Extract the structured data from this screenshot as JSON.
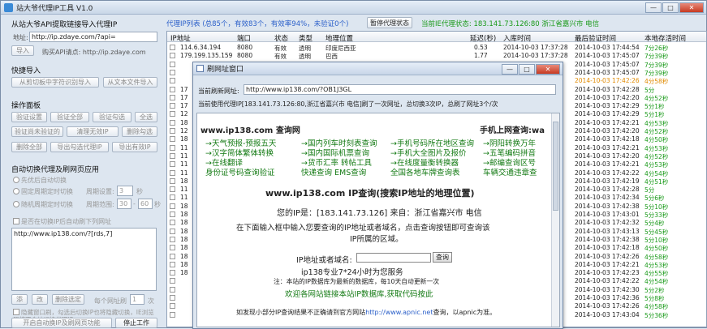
{
  "app": {
    "title": "站大爷代理IP工具 V1.0"
  },
  "left": {
    "api_section": "从站大爷API提取链接导入代理IP",
    "api_label": "地址:",
    "api_value": "http://ip.zdaye.com/?api=",
    "import_btn": "导入",
    "buy_label": "购买API请点: http://ip.zdaye.com",
    "quick_section": "快捷导入",
    "clip_btn": "从剪切板中字符识别导入",
    "text_btn": "从文本文件导入",
    "ops_section": "操作面板",
    "ops_row1": [
      "验证设置",
      "验证全部",
      "验证勾选",
      "全选"
    ],
    "ops_row2": [
      "验证尚未验证的",
      "清理无效IP",
      "删除勾选"
    ],
    "ops_row3": [
      "删除全部",
      "导出勾选代理IP",
      "导出有效IP"
    ],
    "auto_section": "自动切换代理及刷网页应用",
    "opt1": "先优后自动切换",
    "opt2": "固定周期定时切换",
    "opt2_label": "周期设置:",
    "opt2_value": "3",
    "opt2_unit": "秒",
    "opt3": "随机周期定时切换",
    "opt3_label": "周期范围:",
    "opt3_from": "30",
    "opt3_sep": "-",
    "opt3_to": "60",
    "opt3_unit": "秒",
    "refresh_check": "是否在切换IP后自动刷下列网址",
    "url_text": "http://www.ip138.com/?[rds,7]",
    "bottom_btns": [
      "添",
      "改",
      "删除选定"
    ],
    "per_ip_label": "每个网址刷",
    "per_ip_value": "1",
    "per_ip_unit": "次",
    "hide_check": "隐藏窗口刷，勾选后切换IP也将隐藏切换，IE浏览器将不会被切换代理IP",
    "start_btn": "开启自动换IP及刷网页功能",
    "stop_btn": "停止工作"
  },
  "topbar": {
    "summary": "代理IP列表 (总85个，有效83个，有效率94%，未验证0个)",
    "pause_btn": "暂停代理状态",
    "status": "当前IE代理状态: 183.141.73.126:80  浙江省嘉兴市 电信"
  },
  "table": {
    "headers": [
      "IP地址",
      "端口",
      "状态",
      "类型",
      "地理位置",
      "延迟(秒)",
      "入库时间",
      "最后验证时间",
      "本地存活时间"
    ],
    "rows": [
      {
        "ip": "114.6.34.194",
        "port": "8080",
        "status": "有效",
        "type": "透明",
        "loc": "印度尼西亚",
        "delay": "0.53",
        "added": "2014-10-03 17:37:28",
        "checked": "2014-10-03 17:44:54",
        "alive": "7分26秒",
        "ac": "g"
      },
      {
        "ip": "179.199.135.159",
        "port": "8080",
        "status": "有效",
        "type": "透明",
        "loc": "巴西",
        "delay": "1.77",
        "added": "2014-10-03 17:37:28",
        "checked": "2014-10-03 17:45:07",
        "alive": "7分39秒",
        "ac": "g"
      },
      {
        "ip": "",
        "port": "",
        "status": "",
        "type": "",
        "loc": "",
        "delay": "",
        "added": "",
        "checked": "2014-10-03 17:45:07",
        "alive": "7分39秒",
        "ac": "g"
      },
      {
        "ip": "",
        "port": "",
        "status": "",
        "type": "",
        "loc": "",
        "delay": "",
        "added": "",
        "checked": "2014-10-03 17:45:07",
        "alive": "7分39秒",
        "ac": "g"
      },
      {
        "ip": "",
        "port": "",
        "status": "",
        "type": "",
        "loc": "",
        "delay": "",
        "added": "",
        "checked": "2014-10-03 17:42:26",
        "alive": "4分58秒",
        "ac": "o"
      },
      {
        "ip": "17",
        "port": "",
        "status": "",
        "type": "",
        "loc": "",
        "delay": "",
        "added": "",
        "checked": "2014-10-03 17:42:28",
        "alive": "5分",
        "ac": "g"
      },
      {
        "ip": "17",
        "port": "",
        "status": "",
        "type": "",
        "loc": "",
        "delay": "",
        "added": "",
        "checked": "2014-10-03 17:42:20",
        "alive": "4分52秒",
        "ac": "g"
      },
      {
        "ip": "17",
        "port": "",
        "status": "",
        "type": "",
        "loc": "",
        "delay": "",
        "added": "",
        "checked": "2014-10-03 17:42:29",
        "alive": "5分1秒",
        "ac": "g"
      },
      {
        "ip": "12",
        "port": "",
        "status": "",
        "type": "",
        "loc": "",
        "delay": "",
        "added": "",
        "checked": "2014-10-03 17:42:29",
        "alive": "5分1秒",
        "ac": "g"
      },
      {
        "ip": "18",
        "port": "",
        "status": "",
        "type": "",
        "loc": "",
        "delay": "",
        "added": "",
        "checked": "2014-10-03 17:42:21",
        "alive": "4分53秒",
        "ac": "g"
      },
      {
        "ip": "12",
        "port": "",
        "status": "",
        "type": "",
        "loc": "",
        "delay": "",
        "added": "",
        "checked": "2014-10-03 17:42:20",
        "alive": "4分52秒",
        "ac": "g"
      },
      {
        "ip": "18",
        "port": "",
        "status": "",
        "type": "",
        "loc": "",
        "delay": "",
        "added": "",
        "checked": "2014-10-03 17:42:18",
        "alive": "4分50秒",
        "ac": "g"
      },
      {
        "ip": "11",
        "port": "",
        "status": "",
        "type": "",
        "loc": "",
        "delay": "",
        "added": "",
        "checked": "2014-10-03 17:42:21",
        "alive": "4分53秒",
        "ac": "g"
      },
      {
        "ip": "11",
        "port": "",
        "status": "",
        "type": "",
        "loc": "",
        "delay": "",
        "added": "",
        "checked": "2014-10-03 17:42:20",
        "alive": "4分52秒",
        "ac": "g"
      },
      {
        "ip": "11",
        "port": "",
        "status": "",
        "type": "",
        "loc": "",
        "delay": "",
        "added": "",
        "checked": "2014-10-03 17:42:21",
        "alive": "4分53秒",
        "ac": "g"
      },
      {
        "ip": "11",
        "port": "",
        "status": "",
        "type": "",
        "loc": "",
        "delay": "",
        "added": "",
        "checked": "2014-10-03 17:42:22",
        "alive": "4分54秒",
        "ac": "g"
      },
      {
        "ip": "18",
        "port": "",
        "status": "",
        "type": "",
        "loc": "",
        "delay": "",
        "added": "",
        "checked": "2014-10-03 17:42:19",
        "alive": "4分51秒",
        "ac": "g"
      },
      {
        "ip": "11",
        "port": "",
        "status": "",
        "type": "",
        "loc": "",
        "delay": "",
        "added": "",
        "checked": "2014-10-03 17:42:28",
        "alive": "5分",
        "ac": "g"
      },
      {
        "ip": "11",
        "port": "",
        "status": "",
        "type": "",
        "loc": "",
        "delay": "",
        "added": "",
        "checked": "2014-10-03 17:42:34",
        "alive": "5分6秒",
        "ac": "g"
      },
      {
        "ip": "18",
        "port": "",
        "status": "",
        "type": "",
        "loc": "",
        "delay": "",
        "added": "",
        "checked": "2014-10-03 17:42:38",
        "alive": "5分10秒",
        "ac": "g"
      },
      {
        "ip": "18",
        "port": "",
        "status": "",
        "type": "",
        "loc": "",
        "delay": "",
        "added": "",
        "checked": "2014-10-03 17:43:01",
        "alive": "5分33秒",
        "ac": "g"
      },
      {
        "ip": "18",
        "port": "",
        "status": "",
        "type": "",
        "loc": "",
        "delay": "",
        "added": "",
        "checked": "2014-10-03 17:42:32",
        "alive": "5分4秒",
        "ac": "g"
      },
      {
        "ip": "18",
        "port": "",
        "status": "",
        "type": "",
        "loc": "",
        "delay": "",
        "added": "",
        "checked": "2014-10-03 17:43:13",
        "alive": "5分45秒",
        "ac": "g"
      },
      {
        "ip": "18",
        "port": "",
        "status": "",
        "type": "",
        "loc": "",
        "delay": "",
        "added": "",
        "checked": "2014-10-03 17:42:38",
        "alive": "5分10秒",
        "ac": "g"
      },
      {
        "ip": "18",
        "port": "",
        "status": "",
        "type": "",
        "loc": "",
        "delay": "",
        "added": "",
        "checked": "2014-10-03 17:42:18",
        "alive": "4分50秒",
        "ac": "g"
      },
      {
        "ip": "18",
        "port": "",
        "status": "",
        "type": "",
        "loc": "",
        "delay": "",
        "added": "",
        "checked": "2014-10-03 17:42:26",
        "alive": "4分58秒",
        "ac": "g"
      },
      {
        "ip": "18",
        "port": "",
        "status": "",
        "type": "",
        "loc": "",
        "delay": "",
        "added": "",
        "checked": "2014-10-03 17:42:21",
        "alive": "4分53秒",
        "ac": "g"
      },
      {
        "ip": "18",
        "port": "",
        "status": "",
        "type": "",
        "loc": "",
        "delay": "",
        "added": "",
        "checked": "2014-10-03 17:42:23",
        "alive": "4分55秒",
        "ac": "g"
      },
      {
        "ip": "",
        "port": "",
        "status": "",
        "type": "",
        "loc": "",
        "delay": "",
        "added": "",
        "checked": "2014-10-03 17:42:22",
        "alive": "4分54秒",
        "ac": "g"
      },
      {
        "ip": "",
        "port": "",
        "status": "",
        "type": "",
        "loc": "",
        "delay": "",
        "added": "",
        "checked": "2014-10-03 17:42:30",
        "alive": "5分2秒",
        "ac": "g"
      },
      {
        "ip": "",
        "port": "",
        "status": "",
        "type": "",
        "loc": "",
        "delay": "",
        "added": "",
        "checked": "2014-10-03 17:42:36",
        "alive": "5分8秒",
        "ac": "g"
      },
      {
        "ip": "",
        "port": "",
        "status": "",
        "type": "",
        "loc": "",
        "delay": "",
        "added": "",
        "checked": "2014-10-03 17:42:26",
        "alive": "4分58秒",
        "ac": "g"
      },
      {
        "ip": "",
        "port": "",
        "status": "",
        "type": "",
        "loc": "",
        "delay": "",
        "added": "",
        "checked": "2014-10-03 17:43:04",
        "alive": "5分36秒",
        "ac": "g"
      }
    ]
  },
  "dialog": {
    "title": "刷网址窗口",
    "url_label": "当前刷新网址:",
    "url_value": "http://www.ip138.com/?OB1J3GL",
    "info": "当前使用代理IP[183.141.73.126:80,浙江省嘉兴市 电信]刷了一次网址，总切换3次IP，总刷了网址3个/次",
    "page": {
      "site": "www.ip138.com 查询网",
      "mobile": "手机上网查询:wa",
      "links": [
        [
          "→天气预报-预报五天",
          "→国内列车时刻表查询",
          "→手机号码所在地区查询",
          "→阴阳转换万年"
        ],
        [
          "→汉字简体繁体转换",
          "→国内国际机票查询",
          "→手机大全图片及报价",
          "→五笔编码拼音"
        ],
        [
          "→在线翻译",
          "→货币汇率 转帖工具",
          "→在线度量衡转换器",
          "→邮编查询区号"
        ],
        [
          "身份证号码查询验证",
          "快递查询 EMS查询",
          "全国各地车牌查询表",
          "车辆交通违章查"
        ]
      ],
      "heading": "www.ip138.com IP查询(搜索IP地址的地理位置)",
      "your_ip": "您的IP是：[183.141.73.126] 来自：浙江省嘉兴市 电信",
      "hint1": "在下面输入框中输入您要查询的IP地址或者域名，点击查询按钮即可查询该",
      "hint2": "IP所属的区域。",
      "query_label": "IP地址或者域名:",
      "query_btn": "查询",
      "service": "ip138专业7*24小时为您服务",
      "note": "注：本站的IP数据库为最新的数据库，每10天自动更新一次",
      "welcome": "欢迎各网站链接本站IP数据库,获取代码按此",
      "footer_a": "如发现小部分IP查询结果不正确请到官方网站",
      "footer_link": "http://www.apnic.net",
      "footer_b": "查询，以apnic为准。"
    }
  },
  "icons": {
    "app": "app-icon",
    "window": "window-icon"
  }
}
